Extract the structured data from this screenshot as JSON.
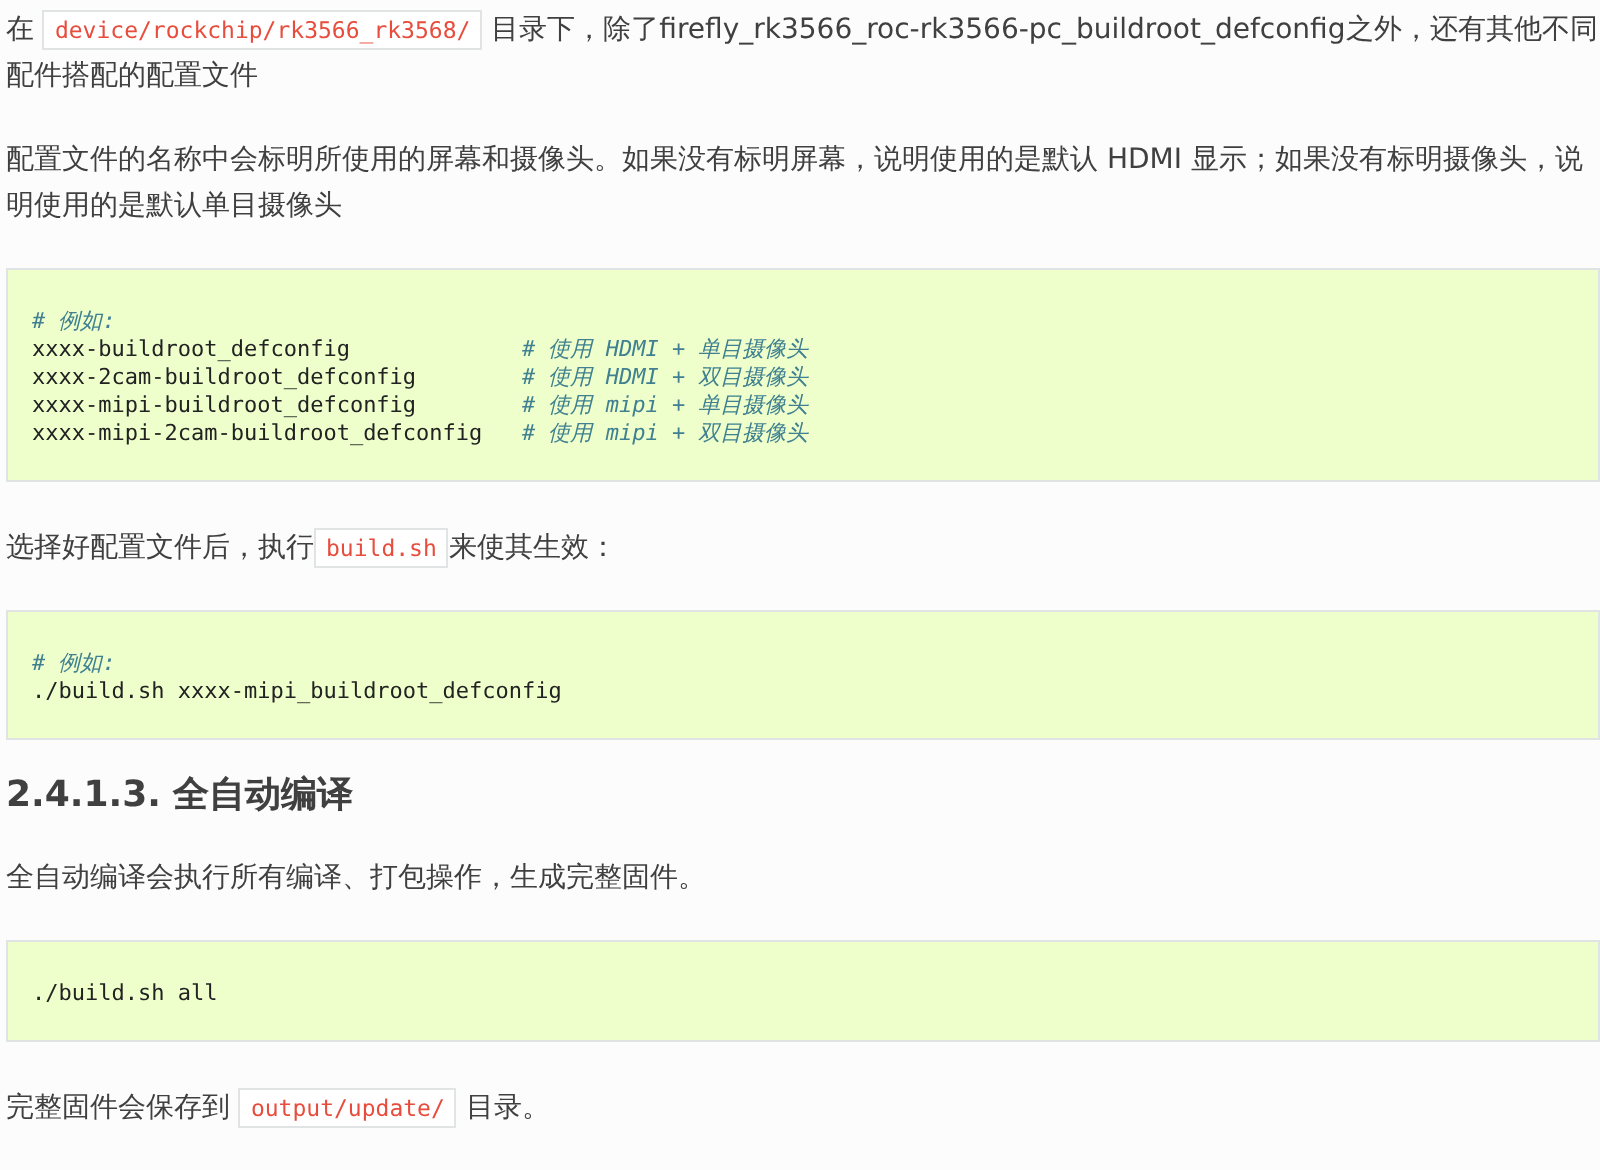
{
  "blocks": [
    {
      "kind": "paragraph",
      "segments": [
        {
          "kind": "text",
          "text": "在 "
        },
        {
          "kind": "code",
          "text": "device/rockchip/rk3566_rk3568/"
        },
        {
          "kind": "text",
          "text": " 目录下，除了firefly_rk3566_roc-rk3566-pc_buildroot_defconfig之外，还有其他不同配件搭配的配置文件"
        }
      ]
    },
    {
      "kind": "paragraph",
      "segments": [
        {
          "kind": "text",
          "text": "配置文件的名称中会标明所使用的屏幕和摄像头。如果没有标明屏幕，说明使用的是默认 HDMI 显示；如果没有标明摄像头，说明使用的是默认单目摄像头"
        }
      ]
    },
    {
      "kind": "codeblock",
      "lines": [
        {
          "comment": "# 例如:"
        },
        {
          "code": "xxxx-buildroot_defconfig",
          "comment": "# 使用 HDMI + 单目摄像头"
        },
        {
          "code": "xxxx-2cam-buildroot_defconfig",
          "comment": "# 使用 HDMI + 双目摄像头"
        },
        {
          "code": "xxxx-mipi-buildroot_defconfig",
          "comment": "# 使用 mipi + 单目摄像头"
        },
        {
          "code": "xxxx-mipi-2cam-buildroot_defconfig",
          "comment": "# 使用 mipi + 双目摄像头"
        }
      ]
    },
    {
      "kind": "paragraph",
      "segments": [
        {
          "kind": "text",
          "text": "选择好配置文件后，执行"
        },
        {
          "kind": "code",
          "text": "build.sh"
        },
        {
          "kind": "text",
          "text": "来使其生效："
        }
      ]
    },
    {
      "kind": "codeblock",
      "lines": [
        {
          "comment": "# 例如:"
        },
        {
          "code": "./build.sh xxxx-mipi_buildroot_defconfig"
        }
      ]
    },
    {
      "kind": "heading",
      "text": "2.4.1.3. 全自动编译"
    },
    {
      "kind": "paragraph",
      "segments": [
        {
          "kind": "text",
          "text": "全自动编译会执行所有编译、打包操作，生成完整固件。"
        }
      ]
    },
    {
      "kind": "codeblock",
      "lines": [
        {
          "code": "./build.sh all"
        }
      ]
    },
    {
      "kind": "paragraph",
      "segments": [
        {
          "kind": "text",
          "text": "完整固件会保存到 "
        },
        {
          "kind": "code",
          "text": "output/update/"
        },
        {
          "kind": "text",
          "text": " 目录。"
        }
      ]
    }
  ]
}
